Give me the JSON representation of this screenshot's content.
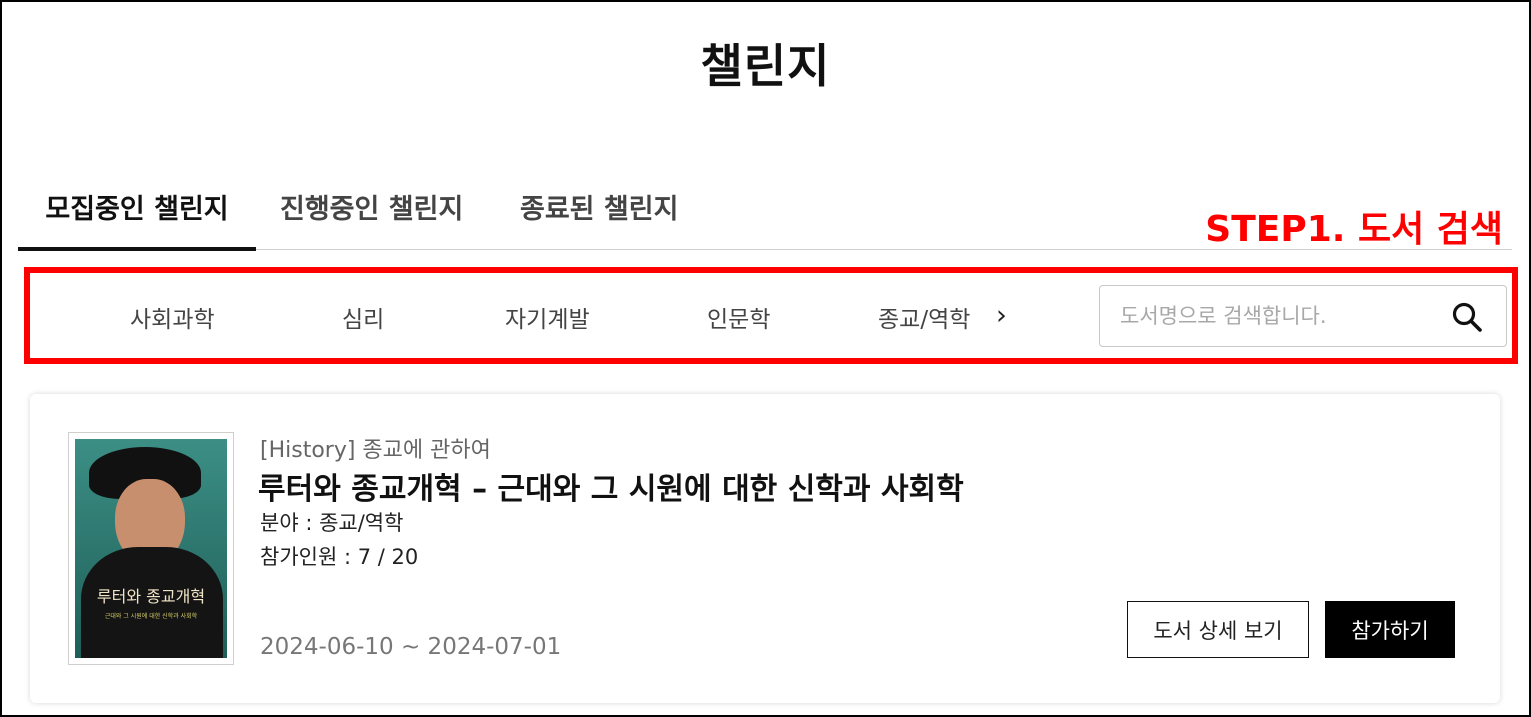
{
  "page": {
    "title": "챌린지"
  },
  "tabs": [
    {
      "label": "모집중인 챌린지",
      "active": true
    },
    {
      "label": "진행중인 챌린지",
      "active": false
    },
    {
      "label": "종료된 챌린지",
      "active": false
    }
  ],
  "annotation": {
    "step_label": "STEP1. 도서 검색",
    "color": "#ff0000"
  },
  "categories": {
    "items": [
      "사회과학",
      "심리",
      "자기계발",
      "인문학",
      "종교/역학"
    ],
    "next_icon": "chevron-right-icon"
  },
  "search": {
    "placeholder": "도서명으로 검색합니다.",
    "value": "",
    "icon": "search-icon"
  },
  "challenge_card": {
    "category_tag": "[History] 종교에 관하여",
    "title": "루터와 종교개혁 – 근대와 그 시원에 대한 신학과 사회학",
    "field": "분야 : 종교/역학",
    "participants": "참가인원 : 7 / 20",
    "period": "2024-06-10 ~ 2024-07-01",
    "cover": {
      "title": "루터와 종교개혁",
      "subtitle": "근대와 그 시원에 대한 신학과 사회학"
    },
    "detail_button": "도서 상세 보기",
    "join_button": "참가하기"
  }
}
